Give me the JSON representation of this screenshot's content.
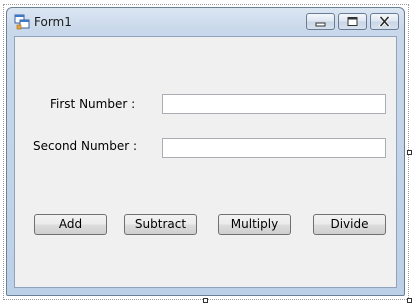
{
  "window": {
    "title": "Form1",
    "controls": {
      "minimize": "minimize-icon",
      "maximize": "maximize-icon",
      "close": "close-icon"
    }
  },
  "form": {
    "first_number_label": "First Number :",
    "first_number_value": "",
    "second_number_label": "Second Number :",
    "second_number_value": ""
  },
  "buttons": {
    "add": "Add",
    "subtract": "Subtract",
    "multiply": "Multiply",
    "divide": "Divide"
  }
}
